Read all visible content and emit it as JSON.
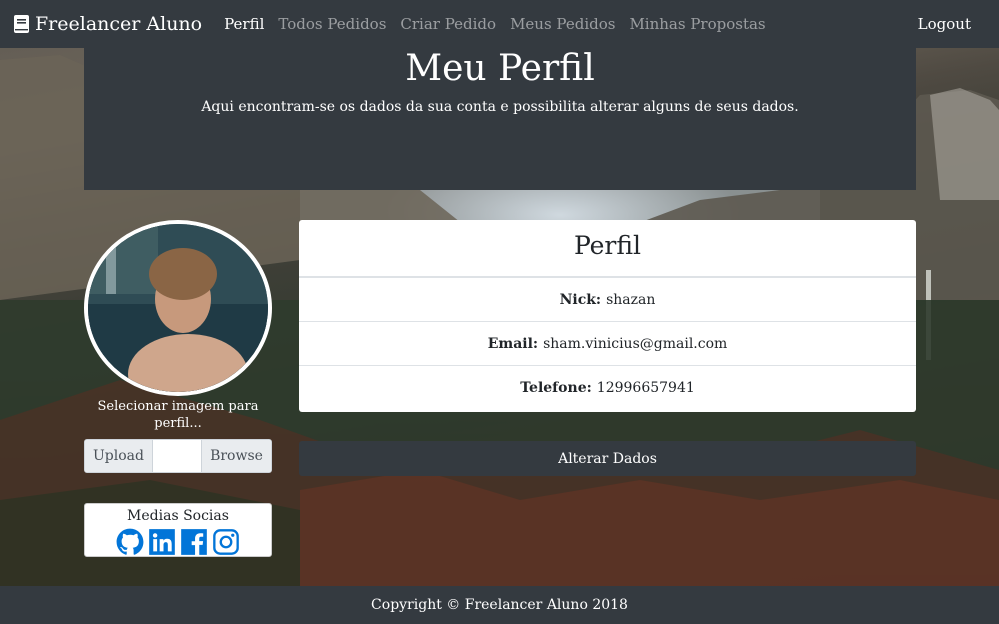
{
  "navbar": {
    "brand": "Freelancer Aluno",
    "links": [
      "Perfil",
      "Todos Pedidos",
      "Criar Pedido",
      "Meus Pedidos",
      "Minhas Propostas"
    ],
    "logout": "Logout"
  },
  "header": {
    "title": "Meu Perfil",
    "subtitle": "Aqui encontram-se os dados da sua conta e possibilita alterar alguns de seus dados."
  },
  "avatar": {
    "select_label": "Selecionar imagem para perfil...",
    "upload_label": "Upload",
    "browse_label": "Browse"
  },
  "social": {
    "title": "Medias Socias",
    "icons": [
      "github-icon",
      "linkedin-icon",
      "facebook-icon",
      "instagram-icon"
    ],
    "color": "#0275d8"
  },
  "profile": {
    "title": "Perfil",
    "nick_label": "Nick:",
    "nick": "shazan",
    "email_label": "Email:",
    "email": "sham.vinicius@gmail.com",
    "phone_label": "Telefone:",
    "phone": "12996657941"
  },
  "actions": {
    "alter_label": "Alterar Dados"
  },
  "footer": {
    "text": "Copyright © Freelancer Aluno 2018"
  },
  "colors": {
    "dark": "#343a40",
    "white": "#ffffff"
  }
}
